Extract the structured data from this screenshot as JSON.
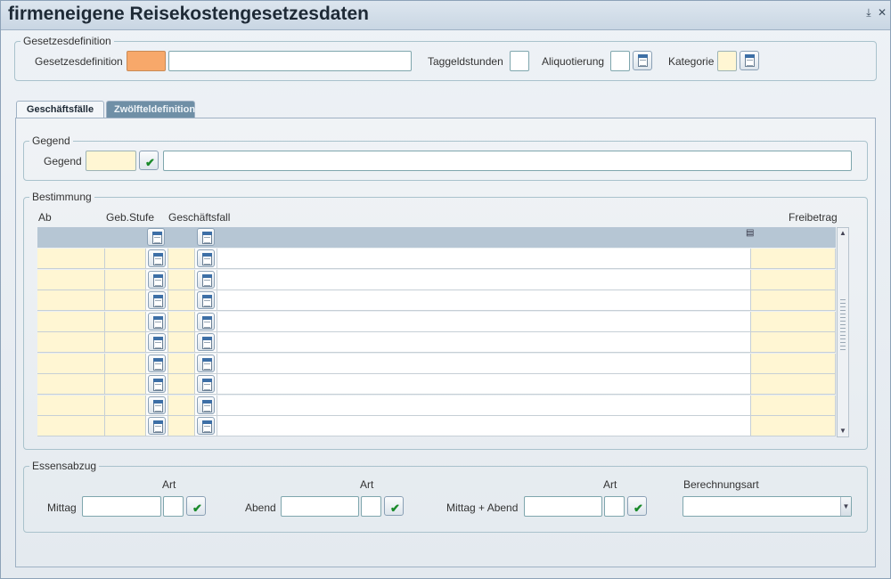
{
  "window": {
    "title": "firmeneigene Reisekostengesetzesdaten",
    "minimize_label": "⤓",
    "close_label": "✕"
  },
  "gesetzesdefinition": {
    "legend": "Gesetzesdefinition",
    "field_label": "Gesetzesdefinition",
    "code_value": "",
    "name_value": "",
    "taggeldstunden_label": "Taggeldstunden",
    "taggeldstunden_value": "",
    "aliquotierung_label": "Aliquotierung",
    "aliquotierung_value": "",
    "kategorie_label": "Kategorie",
    "kategorie_value": ""
  },
  "tabs": [
    {
      "label": "Geschäftsfälle",
      "active": true
    },
    {
      "label": "Zwölfteldefinition",
      "active": false
    }
  ],
  "gegend": {
    "legend": "Gegend",
    "field_label": "Gegend",
    "code_value": "",
    "name_value": ""
  },
  "bestimmung": {
    "legend": "Bestimmung",
    "columns": {
      "ab": "Ab",
      "geb_stufe": "Geb.Stufe",
      "geschaeftsfall": "Geschäftsfall",
      "freibetrag": "Freibetrag"
    },
    "row_count": 9
  },
  "essensabzug": {
    "legend": "Essensabzug",
    "art_label": "Art",
    "mittag_label": "Mittag",
    "abend_label": "Abend",
    "mittag_abend_label": "Mittag + Abend",
    "berechnungsart_label": "Berechnungsart",
    "berechnungsart_value": ""
  },
  "colors": {
    "required_field": "#f7a86a",
    "optional_field": "#fff6d3",
    "grid_header": "#b6c6d4",
    "inactive_tab": "#6f8fa6"
  },
  "icons": {
    "lov": "calendar-list-icon",
    "lov_check": "checkmark-icon"
  }
}
